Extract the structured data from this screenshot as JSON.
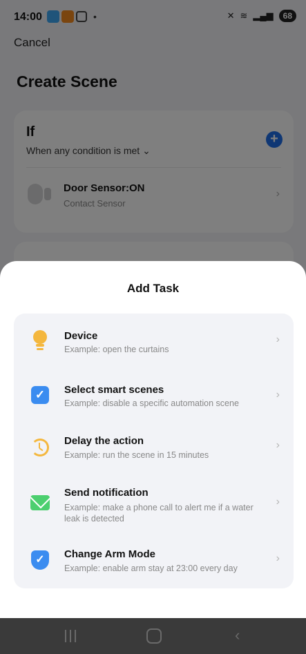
{
  "status_bar": {
    "time": "14:00",
    "battery": "68"
  },
  "header": {
    "cancel_label": "Cancel",
    "title": "Create Scene"
  },
  "if_section": {
    "title": "If",
    "condition_mode": "When any condition is met ⌄",
    "add_icon": "plus-circle-icon",
    "condition": {
      "name": "Door Sensor:ON",
      "type": "Contact Sensor"
    }
  },
  "sheet": {
    "title": "Add Task",
    "items": [
      {
        "label": "Device",
        "desc": "Example: open the curtains",
        "icon": "lightbulb-icon",
        "color": "#f4b73e"
      },
      {
        "label": "Select smart scenes",
        "desc": "Example: disable a specific automation scene",
        "icon": "checkbox-icon",
        "color": "#3b8cf0"
      },
      {
        "label": "Delay the action",
        "desc": "Example: run the scene in 15 minutes",
        "icon": "clock-icon",
        "color": "#f4b73e"
      },
      {
        "label": "Send notification",
        "desc": "Example: make a phone call to alert me if a water leak is detected",
        "icon": "envelope-icon",
        "color": "#4ccf6f"
      },
      {
        "label": "Change Arm Mode",
        "desc": "Example: enable arm stay at 23:00 every day",
        "icon": "shield-check-icon",
        "color": "#3b8cf0"
      }
    ]
  },
  "colors": {
    "accent": "#1f6fe8",
    "sheet_background": "#ffffff",
    "list_background": "#f2f3f7"
  }
}
